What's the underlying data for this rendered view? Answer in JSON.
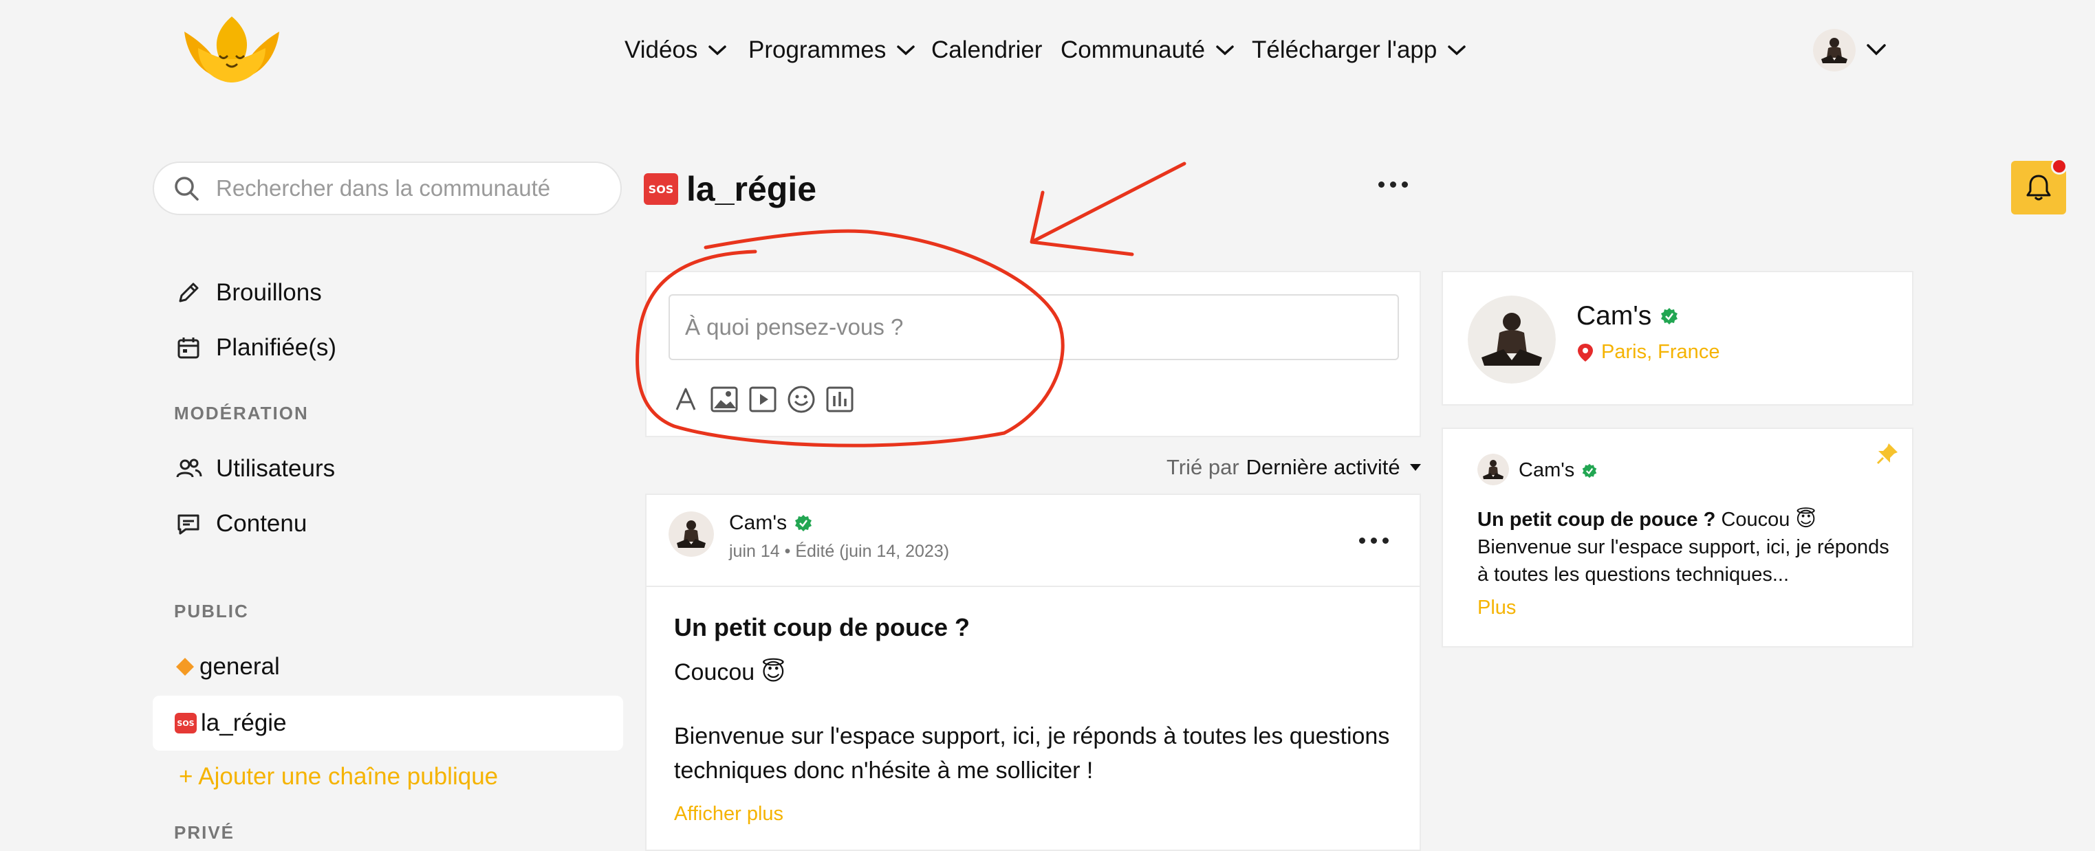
{
  "header": {
    "nav": [
      {
        "label": "Vidéos",
        "has_dropdown": true
      },
      {
        "label": "Programmes",
        "has_dropdown": true
      },
      {
        "label": "Calendrier",
        "has_dropdown": false
      },
      {
        "label": "Communauté",
        "has_dropdown": true
      },
      {
        "label": "Télécharger l'app",
        "has_dropdown": true
      }
    ]
  },
  "search": {
    "placeholder": "Rechercher dans la communauté"
  },
  "sidebar": {
    "items": [
      {
        "label": "Brouillons",
        "icon": "pencil-icon"
      },
      {
        "label": "Planifiée(s)",
        "icon": "calendar-icon"
      }
    ],
    "moderation_heading": "MODÉRATION",
    "moderation": [
      {
        "label": "Utilisateurs",
        "icon": "users-icon"
      },
      {
        "label": "Contenu",
        "icon": "message-icon"
      }
    ],
    "public_heading": "PUBLIC",
    "public_channels": [
      {
        "emoji": "🔶",
        "label": "general",
        "active": false
      },
      {
        "emoji": "🆘",
        "label": "la_régie",
        "active": true
      }
    ],
    "add_public": "+ Ajouter une chaîne publique",
    "private_heading": "PRIVÉ"
  },
  "channel": {
    "emoji": "🆘",
    "name": "la_régie"
  },
  "composer": {
    "placeholder": "À quoi pensez-vous ?",
    "tools": [
      "text-format-icon",
      "image-icon",
      "video-icon",
      "emoji-icon",
      "poll-icon"
    ]
  },
  "sort": {
    "prefix": "Trié par",
    "value": "Dernière activité"
  },
  "post": {
    "author": "Cam's",
    "meta": "juin 14 • Édité (juin 14, 2023)",
    "title": "Un petit coup de pouce ?",
    "line1": "Coucou 😇",
    "body": "Bienvenue sur l'espace support, ici, je réponds à toutes les questions techniques donc n'hésite à me solliciter !",
    "more": "Afficher plus"
  },
  "profile": {
    "name": "Cam's",
    "location": "Paris, France"
  },
  "pinned": {
    "author": "Cam's",
    "title": "Un petit coup de pouce ?",
    "text": " Coucou 😇 Bienvenue sur l'espace support, ici, je réponds à toutes les questions techniques...",
    "more": "Plus"
  },
  "colors": {
    "accent": "#f5b301",
    "bell": "#f8c133",
    "annotation": "#e8341c",
    "verified": "#22a652"
  }
}
